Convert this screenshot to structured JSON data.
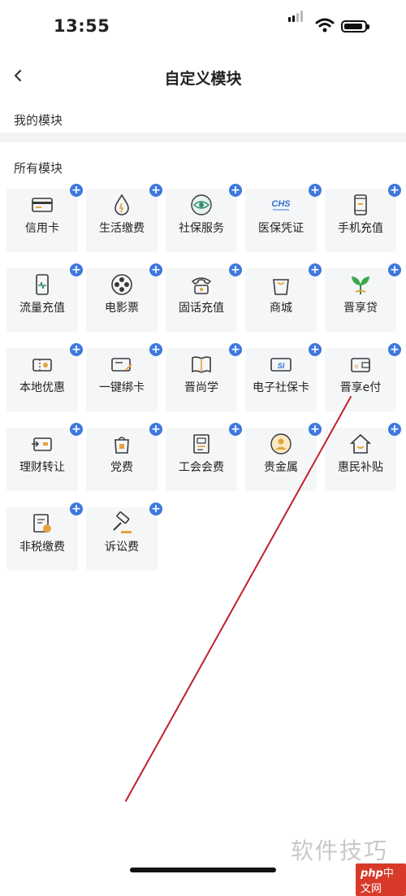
{
  "status_bar": {
    "time": "13:55"
  },
  "nav": {
    "title": "自定义模块"
  },
  "sections": {
    "mine": "我的模块",
    "all": "所有模块"
  },
  "modules": [
    {
      "label": "信用卡",
      "icon": "credit-card-icon"
    },
    {
      "label": "生活缴费",
      "icon": "water-drop-icon"
    },
    {
      "label": "社保服务",
      "icon": "eye-icon"
    },
    {
      "label": "医保凭证",
      "icon": "chs-badge-icon"
    },
    {
      "label": "手机充值",
      "icon": "mobile-phone-icon"
    },
    {
      "label": "流量充值",
      "icon": "data-phone-icon"
    },
    {
      "label": "电影票",
      "icon": "film-reel-icon"
    },
    {
      "label": "固话充值",
      "icon": "telephone-icon"
    },
    {
      "label": "商城",
      "icon": "shopping-bag-icon"
    },
    {
      "label": "晋享贷",
      "icon": "sprout-icon"
    },
    {
      "label": "本地优惠",
      "icon": "coupon-icon"
    },
    {
      "label": "一键绑卡",
      "icon": "card-pen-icon"
    },
    {
      "label": "晋尚学",
      "icon": "open-book-icon"
    },
    {
      "label": "电子社保卡",
      "icon": "si-card-icon"
    },
    {
      "label": "晋享e付",
      "icon": "wallet-icon"
    },
    {
      "label": "理财转让",
      "icon": "transfer-card-icon"
    },
    {
      "label": "党费",
      "icon": "party-badge-icon"
    },
    {
      "label": "工会会费",
      "icon": "union-document-icon"
    },
    {
      "label": "贵金属",
      "icon": "gold-coin-icon"
    },
    {
      "label": "惠民补贴",
      "icon": "house-smile-icon"
    },
    {
      "label": "非税缴费",
      "icon": "tax-doc-icon"
    },
    {
      "label": "诉讼费",
      "icon": "gavel-icon"
    }
  ],
  "add_badge": "+",
  "watermark": {
    "text": "软件技巧",
    "site": "中文网",
    "brand": "php"
  },
  "colors": {
    "accent": "#3e78de",
    "tile_bg": "#f5f6f8",
    "annotation": "#c0202a"
  }
}
